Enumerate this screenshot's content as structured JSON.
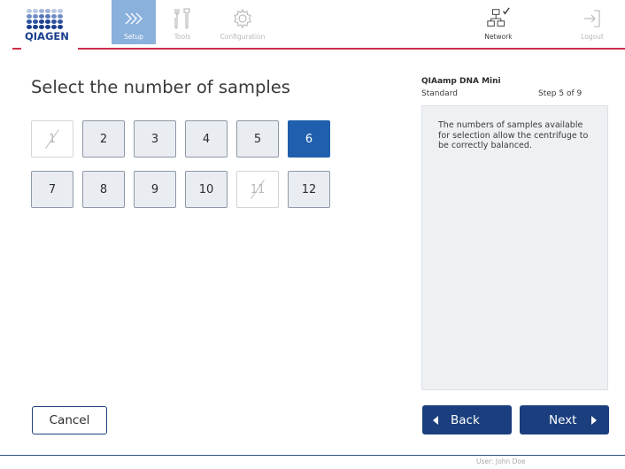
{
  "header": {
    "logo_text": "QIAGEN",
    "nav": [
      {
        "label": "Setup",
        "icon": "setup-chevrons-icon",
        "active": true
      },
      {
        "label": "Tools",
        "icon": "tools-icon",
        "active": false
      },
      {
        "label": "Configuration",
        "icon": "configuration-gear-icon",
        "active": false
      }
    ],
    "network": {
      "label": "Network",
      "icon": "network-connected-icon"
    },
    "logout": {
      "label": "Logout",
      "icon": "logout-icon"
    }
  },
  "main": {
    "title": "Select the number of samples",
    "samples": [
      {
        "value": "1",
        "state": "disabled"
      },
      {
        "value": "2",
        "state": "normal"
      },
      {
        "value": "3",
        "state": "normal"
      },
      {
        "value": "4",
        "state": "normal"
      },
      {
        "value": "5",
        "state": "normal"
      },
      {
        "value": "6",
        "state": "selected"
      },
      {
        "value": "7",
        "state": "normal"
      },
      {
        "value": "8",
        "state": "normal"
      },
      {
        "value": "9",
        "state": "normal"
      },
      {
        "value": "10",
        "state": "normal"
      },
      {
        "value": "11",
        "state": "disabled"
      },
      {
        "value": "12",
        "state": "normal"
      }
    ]
  },
  "panel": {
    "protocol_name": "QIAamp DNA Mini",
    "protocol_mode": "Standard",
    "step": "Step 5 of 9",
    "info_text": "The numbers of samples available for selection allow the centrifuge to be correctly balanced."
  },
  "footer": {
    "cancel_label": "Cancel",
    "back_label": "Back",
    "next_label": "Next",
    "user_label": "User: John Doe"
  },
  "colors": {
    "accent_red": "#cd2e4a",
    "primary_blue": "#1b3f7e",
    "selected_blue": "#1f5fae",
    "setup_tab_blue": "#8ab0dc",
    "logo_blue": "#1a3e8c"
  }
}
